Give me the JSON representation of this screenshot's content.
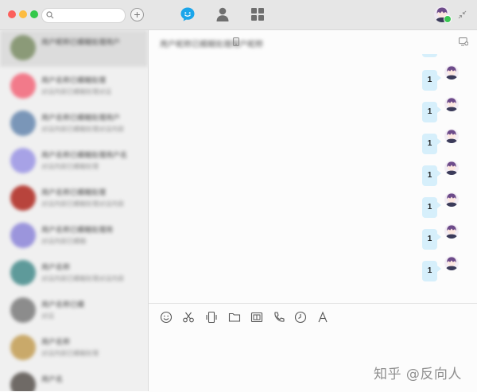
{
  "window": {
    "search": {
      "value": "",
      "placeholder": ""
    },
    "add_label": "+",
    "nav": {
      "active": "chat"
    },
    "colors": {
      "accent": "#1aa5ea",
      "bubble": "#d6effb",
      "presence": "#3ac652"
    }
  },
  "sessions": [
    {
      "name": "用户昵称已模糊处理用户",
      "preview": "",
      "time": ""
    },
    {
      "name": "用户名称已模糊处理",
      "preview": "对话内容已模糊处理对话",
      "time": ""
    },
    {
      "name": "用户名称已模糊处理用户",
      "preview": "对话内容已模糊处理对话内容",
      "time": ""
    },
    {
      "name": "用户名称已模糊处理用户名",
      "preview": "对话内容已模糊处理",
      "time": ""
    },
    {
      "name": "用户名称已模糊处理",
      "preview": "对话内容已模糊处理对话内容",
      "time": ""
    },
    {
      "name": "用户名称已模糊处理用",
      "preview": "对话内容已模糊",
      "time": ""
    },
    {
      "name": "用户名称",
      "preview": "对话内容已模糊处理对话内容",
      "time": ""
    },
    {
      "name": "用户名称已模",
      "preview": "对话",
      "time": ""
    },
    {
      "name": "用户名称",
      "preview": "对话内容已模糊处理",
      "time": ""
    },
    {
      "name": "用户名",
      "preview": "",
      "time": ""
    }
  ],
  "chat": {
    "title": "用户昵称已模糊处理用户昵称",
    "messages": [
      {
        "text": "1"
      },
      {
        "text": "1"
      },
      {
        "text": "1"
      },
      {
        "text": "1"
      },
      {
        "text": "1"
      },
      {
        "text": "1"
      },
      {
        "text": "1"
      }
    ]
  },
  "composer": {
    "tools": [
      "emoji-icon",
      "scissors-icon",
      "shake-icon",
      "folder-icon",
      "image-icon",
      "phone-icon",
      "clock-icon",
      "font-icon"
    ]
  },
  "watermark": "知乎 @反向人"
}
